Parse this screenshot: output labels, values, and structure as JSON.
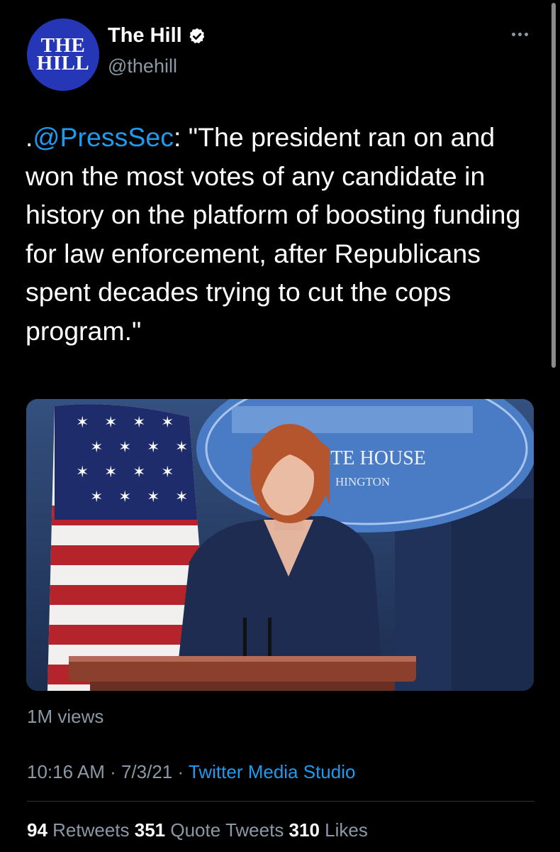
{
  "author": {
    "avatar_line1": "THE",
    "avatar_line2": "HILL",
    "name": "The Hill",
    "handle": "@thehill",
    "verified_icon": "verified-badge-icon"
  },
  "tweet": {
    "prefix": ".",
    "mention": "@PressSec",
    "body": ": \"The president ran on and won the most votes of any candidate in history on the platform of boosting funding for law enforcement, after Republicans spent decades trying to cut the cops program.\""
  },
  "media": {
    "seal_text_1": "ITE HOUSE",
    "seal_text_2": "HINGTON"
  },
  "views": "1M views",
  "meta": {
    "time": "10:16 AM",
    "sep1": " · ",
    "date": "7/3/21",
    "sep2": " · ",
    "source": "Twitter Media Studio"
  },
  "stats": {
    "retweets_count": "94",
    "retweets_label": " Retweets ",
    "quotes_count": "351",
    "quotes_label": " Quote Tweets ",
    "likes_count": "310",
    "likes_label": " Likes"
  },
  "colors": {
    "background": "#000000",
    "link": "#1d9bf0",
    "secondary_text": "#8b98a5",
    "avatar_bg": "#2536b6"
  }
}
